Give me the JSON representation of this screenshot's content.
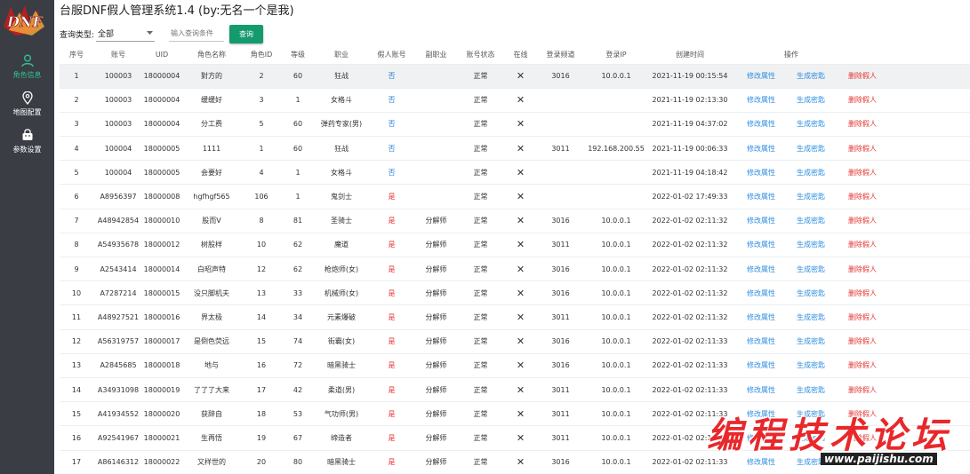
{
  "app": {
    "title": "台服DNF假人管理系统1.4 (by:无名一个是我)"
  },
  "sidebar": {
    "items": [
      {
        "label": "角色信息",
        "icon": "user-icon",
        "active": true
      },
      {
        "label": "地图配置",
        "icon": "location-pin-icon",
        "active": false
      },
      {
        "label": "参数设置",
        "icon": "settings-bag-icon",
        "active": false
      }
    ]
  },
  "filter": {
    "type_label": "查询类型:",
    "type_value": "全部",
    "search_placeholder": "输入查询条件",
    "query_button": "查询"
  },
  "table": {
    "headers": [
      "序号",
      "账号",
      "UID",
      "角色名称",
      "角色ID",
      "等级",
      "职业",
      "假人账号",
      "副职业",
      "账号状态",
      "在线",
      "登录频道",
      "登录IP",
      "创建时间",
      "操作"
    ],
    "action_labels": {
      "edit": "修改属性",
      "gen": "生成密匙",
      "delete": "删除假人"
    },
    "rows": [
      [
        "1",
        "100003",
        "18000004",
        "對方的",
        "2",
        "60",
        "狂战",
        "否",
        "",
        "正常",
        "✕",
        "3016",
        "10.0.0.1",
        "2021-11-19 00:15:54"
      ],
      [
        "2",
        "100003",
        "18000004",
        "缓缓好",
        "3",
        "1",
        "女格斗",
        "否",
        "",
        "正常",
        "✕",
        "",
        "",
        "2021-11-19 02:13:30"
      ],
      [
        "3",
        "100003",
        "18000004",
        "分工费",
        "5",
        "60",
        "弹药专家(男)",
        "否",
        "",
        "正常",
        "✕",
        "",
        "",
        "2021-11-19 04:37:02"
      ],
      [
        "4",
        "100004",
        "18000005",
        "1111",
        "1",
        "60",
        "狂战",
        "否",
        "",
        "正常",
        "✕",
        "3011",
        "192.168.200.55",
        "2021-11-19 00:06:33"
      ],
      [
        "5",
        "100004",
        "18000005",
        "会要好",
        "4",
        "1",
        "女格斗",
        "否",
        "",
        "正常",
        "✕",
        "",
        "",
        "2021-11-19 04:18:42"
      ],
      [
        "6",
        "A8956397",
        "18000008",
        "hgfhgf565",
        "106",
        "1",
        "鬼剑士",
        "是",
        "",
        "正常",
        "✕",
        "",
        "",
        "2022-01-02 17:49:33"
      ],
      [
        "7",
        "A48942854",
        "18000010",
        "股而V",
        "8",
        "81",
        "圣骑士",
        "是",
        "分解师",
        "正常",
        "✕",
        "3016",
        "10.0.0.1",
        "2022-01-02 02:11:32"
      ],
      [
        "8",
        "A54935678",
        "18000012",
        "树股样",
        "10",
        "62",
        "魔道",
        "是",
        "分解师",
        "正常",
        "✕",
        "3011",
        "10.0.0.1",
        "2022-01-02 02:11:32"
      ],
      [
        "9",
        "A2543414",
        "18000014",
        "白昭声特",
        "12",
        "62",
        "枪炮师(女)",
        "是",
        "分解师",
        "正常",
        "✕",
        "3016",
        "10.0.0.1",
        "2022-01-02 02:11:32"
      ],
      [
        "10",
        "A7287214",
        "18000015",
        "没只脚机夫",
        "13",
        "33",
        "机械师(女)",
        "是",
        "分解师",
        "正常",
        "✕",
        "3016",
        "10.0.0.1",
        "2022-01-02 02:11:32"
      ],
      [
        "11",
        "A48927521",
        "18000016",
        "界太极",
        "14",
        "34",
        "元素爆破",
        "是",
        "分解师",
        "正常",
        "✕",
        "3011",
        "10.0.0.1",
        "2022-01-02 02:11:32"
      ],
      [
        "12",
        "A56319757",
        "18000017",
        "是倒色荧远",
        "15",
        "74",
        "街霸(女)",
        "是",
        "分解师",
        "正常",
        "✕",
        "3016",
        "10.0.0.1",
        "2022-01-02 02:11:33"
      ],
      [
        "13",
        "A2845685",
        "18000018",
        "地与",
        "16",
        "72",
        "暗黑骑士",
        "是",
        "分解师",
        "正常",
        "✕",
        "3016",
        "10.0.0.1",
        "2022-01-02 02:11:33"
      ],
      [
        "14",
        "A34931098",
        "18000019",
        "了了了大来",
        "17",
        "42",
        "柔道(男)",
        "是",
        "分解师",
        "正常",
        "✕",
        "3011",
        "10.0.0.1",
        "2022-01-02 02:11:33"
      ],
      [
        "15",
        "A41934552",
        "18000020",
        "获辞自",
        "18",
        "53",
        "气功师(男)",
        "是",
        "分解师",
        "正常",
        "✕",
        "3011",
        "10.0.0.1",
        "2022-01-02 02:11:33"
      ],
      [
        "16",
        "A92541967",
        "18000021",
        "生再悟",
        "19",
        "67",
        "缔造者",
        "是",
        "分解师",
        "正常",
        "✕",
        "3011",
        "10.0.0.1",
        "2022-01-02 02:11:33"
      ],
      [
        "17",
        "A86146312",
        "18000022",
        "又样世的",
        "20",
        "80",
        "暗黑骑士",
        "是",
        "分解师",
        "正常",
        "✕",
        "3016",
        "10.0.0.1",
        "2022-01-02 02:11:33"
      ]
    ]
  },
  "watermark": {
    "text": "编程技术论坛",
    "url": "www.paijishu.com"
  },
  "colors": {
    "sidebar_bg": "#3b3d45",
    "accent": "#149a6f",
    "active_nav": "#2ec28f",
    "link_blue": "#2f8ee0",
    "danger_red": "#e53333"
  }
}
